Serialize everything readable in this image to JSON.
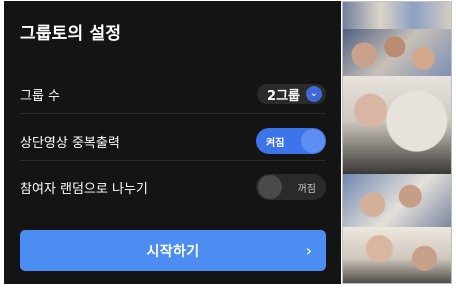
{
  "dialog": {
    "title": "그룹토의 설정",
    "rows": [
      {
        "label": "그룹 수",
        "control": "select",
        "value": "2그룹",
        "icon": "chevron-down-icon"
      },
      {
        "label": "상단영상 중복출력",
        "control": "toggle",
        "state_text": "켜짐",
        "on": true
      },
      {
        "label": "참여자 랜덤으로 나누기",
        "control": "toggle",
        "state_text": "꺼짐",
        "on": false
      }
    ],
    "start_button": {
      "label": "시작하기",
      "icon": "chevron-right-icon"
    },
    "colors": {
      "panel_bg": "#141414",
      "accent": "#3d74ea",
      "button": "#4b8df0"
    }
  }
}
